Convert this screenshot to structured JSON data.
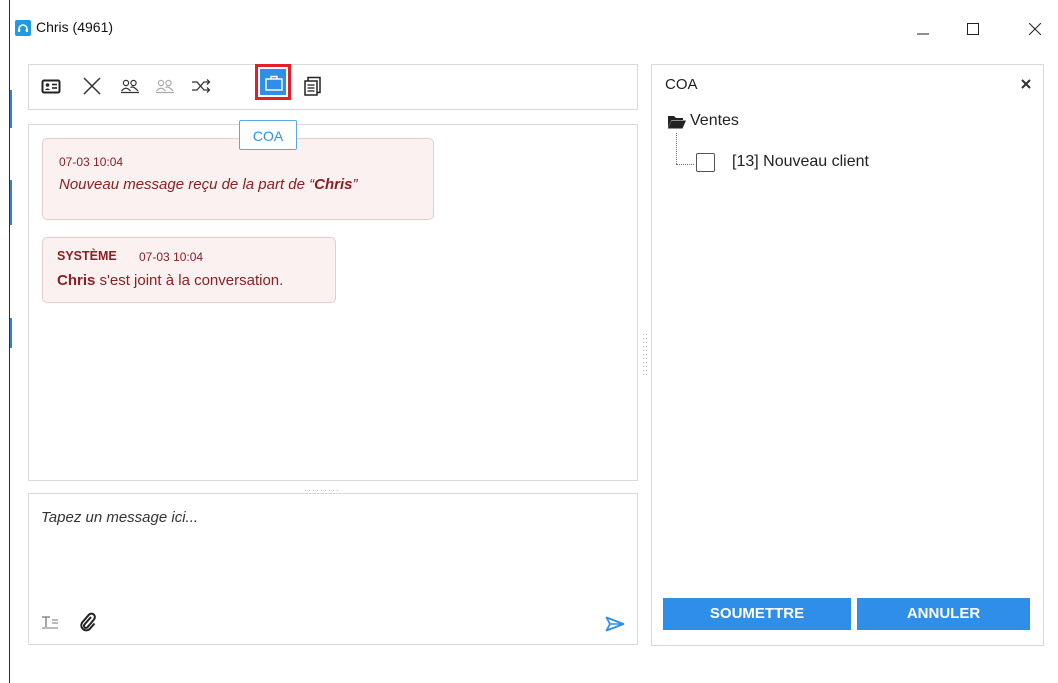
{
  "window": {
    "title": "Chris (4961)"
  },
  "toolbar": {
    "buttons": [
      {
        "icon": "contact-card-icon"
      },
      {
        "icon": "close-x-icon"
      },
      {
        "icon": "transfer-user-icon"
      },
      {
        "icon": "conference-user-icon"
      },
      {
        "icon": "shuffle-icon"
      },
      {
        "icon": "briefcase-icon",
        "active": true
      },
      {
        "icon": "document-list-icon"
      }
    ],
    "tooltip": "COA"
  },
  "chat": {
    "messages": [
      {
        "timestamp": "07-03 10:04",
        "text_prefix": "Nouveau message reçu de la part de ",
        "text_open_quote": "“",
        "text_name": "Chris",
        "text_close_quote": "”"
      },
      {
        "sender": "SYSTÈME",
        "timestamp": "07-03 10:04",
        "text_name": "Chris",
        "text_rest": " s'est joint à la conversation."
      }
    ]
  },
  "composer": {
    "placeholder": "Tapez un message ici..."
  },
  "coa_panel": {
    "title": "COA",
    "folder": "Ventes",
    "items": [
      {
        "label": "[13] Nouveau client",
        "checked": false
      }
    ],
    "submit_label": "SOUMETTRE",
    "cancel_label": "ANNULER"
  },
  "colors": {
    "accent": "#2f8fe8",
    "highlight_border": "#e3202a",
    "message_text": "#8b2020",
    "message_bg": "#fbf1f1"
  }
}
